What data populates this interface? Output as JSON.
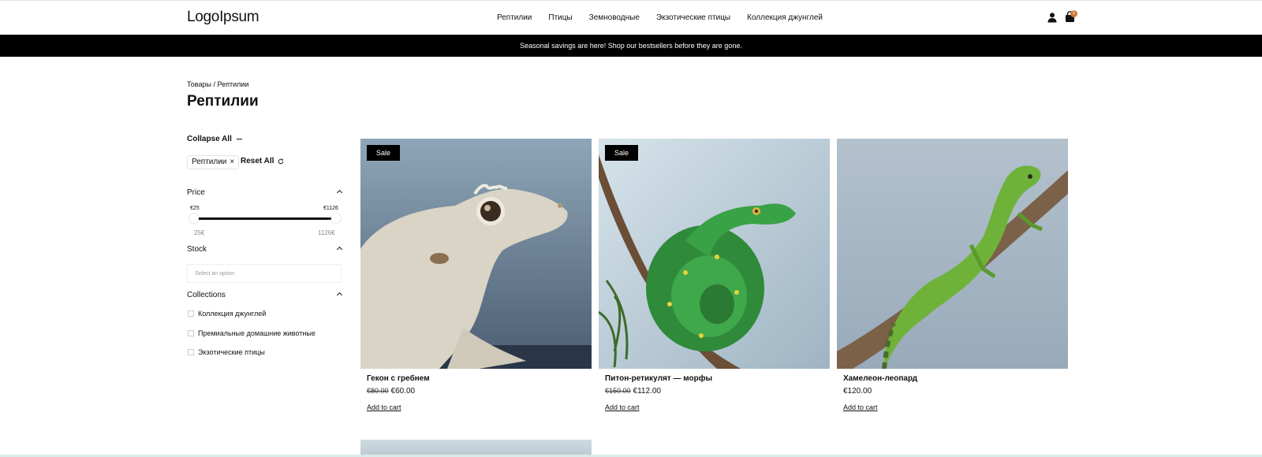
{
  "header": {
    "logo": "LogoIpsum",
    "nav": [
      "Рептилии",
      "Птицы",
      "Земноводные",
      "Экзотические птицы",
      "Коллекция джунглей"
    ],
    "cart_count": "1"
  },
  "promo": "Seasonal savings are here! Shop our bestsellers before they are gone.",
  "breadcrumb": {
    "root": "Товары",
    "separator": " / ",
    "current": "Рептилии"
  },
  "page_title": "Рептилии",
  "filters": {
    "collapse_all": "Collapse All",
    "active_chip": "Рептилии",
    "chip_remove": "×",
    "reset_all": "Reset All",
    "price": {
      "label": "Price",
      "min_label": "€25",
      "max_label": "€1126",
      "range_min": "25€",
      "range_max": "1126€"
    },
    "stock": {
      "label": "Stock",
      "placeholder": "Select an option"
    },
    "collections": {
      "label": "Collections",
      "options": [
        "Коллекция джунглей",
        "Премиальные домашние животные",
        "Экзотические птицы"
      ]
    }
  },
  "products": [
    {
      "name": "Гекон с гребнем",
      "old_price": "€80.00",
      "price": "€60.00",
      "badge": "Sale",
      "cta": "Add to cart"
    },
    {
      "name": "Питон-ретикулят — морфы",
      "old_price": "€150.00",
      "price": "€112.00",
      "badge": "Sale",
      "cta": "Add to cart"
    },
    {
      "name": "Хамелеон-леопард",
      "old_price": "",
      "price": "€120.00",
      "badge": "",
      "cta": "Add to cart"
    }
  ]
}
